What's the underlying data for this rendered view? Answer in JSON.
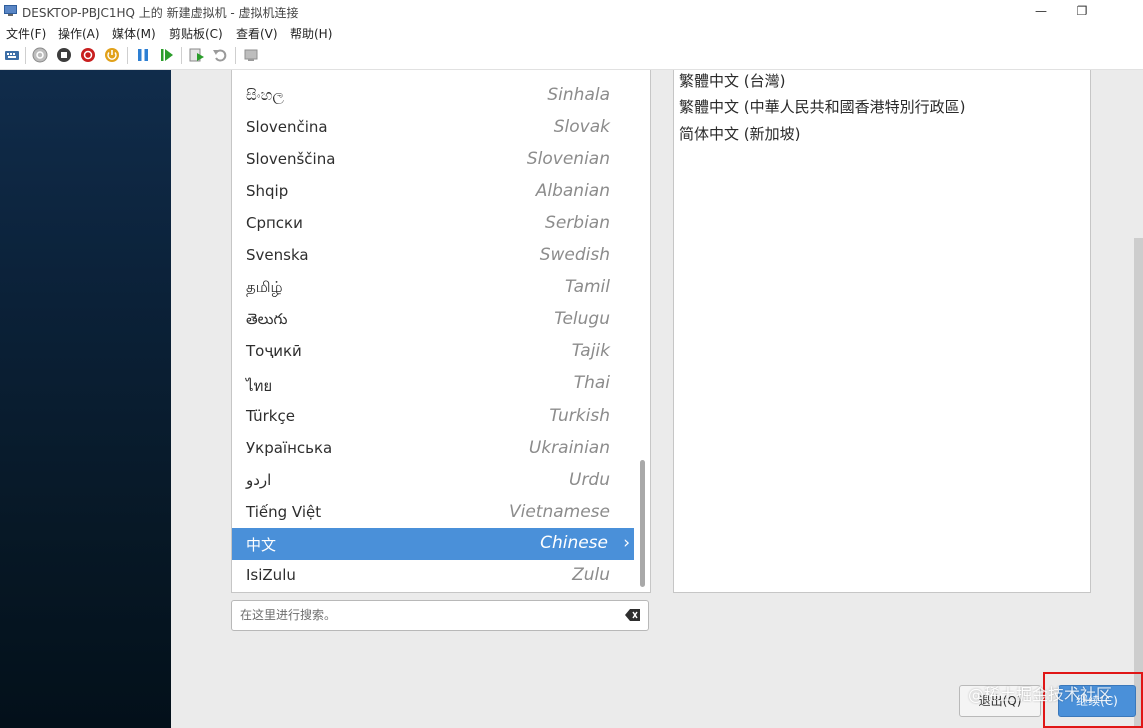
{
  "window": {
    "title": "DESKTOP-PBJC1HQ 上的 新建虚拟机 - 虚拟机连接",
    "minimize_glyph": "—",
    "restore_glyph": "❐"
  },
  "menubar": {
    "items": [
      "文件(F)",
      "操作(A)",
      "媒体(M)",
      "剪贴板(C)",
      "查看(V)",
      "帮助(H)"
    ]
  },
  "toolbar": {
    "icons": [
      "ctrl-alt-del-icon",
      "start-icon",
      "turn-off-icon",
      "shut-down-icon",
      "save-icon",
      "pause-icon",
      "resume-icon",
      "checkpoint-icon",
      "revert-icon",
      "enhanced-session-icon"
    ]
  },
  "language_list": {
    "items": [
      {
        "native": "සිංහල",
        "english": "Sinhala"
      },
      {
        "native": "Slovenčina",
        "english": "Slovak"
      },
      {
        "native": "Slovenščina",
        "english": "Slovenian"
      },
      {
        "native": "Shqip",
        "english": "Albanian"
      },
      {
        "native": "Српски",
        "english": "Serbian"
      },
      {
        "native": "Svenska",
        "english": "Swedish"
      },
      {
        "native": "தமிழ்",
        "english": "Tamil"
      },
      {
        "native": "తెలుగు",
        "english": "Telugu"
      },
      {
        "native": "Тоҷикӣ",
        "english": "Tajik"
      },
      {
        "native": "ไทย",
        "english": "Thai"
      },
      {
        "native": "Türkçe",
        "english": "Turkish"
      },
      {
        "native": "Українська",
        "english": "Ukrainian"
      },
      {
        "native": "اردو",
        "english": "Urdu"
      },
      {
        "native": "Tiếng Việt",
        "english": "Vietnamese"
      },
      {
        "native": "中文",
        "english": "Chinese"
      },
      {
        "native": "IsiZulu",
        "english": "Zulu"
      }
    ],
    "selected": "Chinese"
  },
  "locale_list": {
    "items": [
      "繁體中文 (台灣)",
      "繁體中文 (中華人民共和國香港特別行政區)",
      "简体中文 (新加坡)"
    ]
  },
  "search": {
    "placeholder": "在这里进行搜索。",
    "value": ""
  },
  "buttons": {
    "quit_label": "退出(Q)",
    "continue_label": "继续(C)"
  },
  "watermark": "@稀土掘金技术社区",
  "colors": {
    "accent": "#4a90d9",
    "highlight_border": "#e01616",
    "side_panel": "#0b2138"
  }
}
